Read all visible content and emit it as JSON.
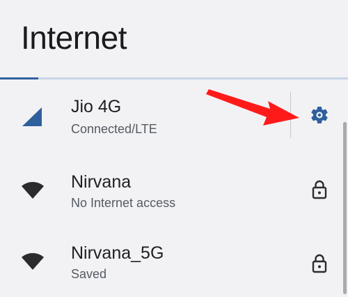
{
  "page": {
    "title": "Internet"
  },
  "progress": {
    "fraction": 0.11,
    "track_color": "#c9d4e6",
    "fill_color": "#2f5f9d"
  },
  "networks": [
    {
      "name": "Jio 4G",
      "status": "Connected/LTE",
      "icon": "cellular-signal-icon",
      "action_icon": "gear-icon"
    },
    {
      "name": "Nirvana",
      "status": "No Internet access",
      "icon": "wifi-icon",
      "action_icon": "lock-icon"
    },
    {
      "name": "Nirvana_5G",
      "status": "Saved",
      "icon": "wifi-icon",
      "action_icon": "lock-icon"
    }
  ],
  "colors": {
    "accent": "#2f5f9d",
    "annotation_arrow": "#ff1a1a",
    "background": "#f2f2f5"
  }
}
